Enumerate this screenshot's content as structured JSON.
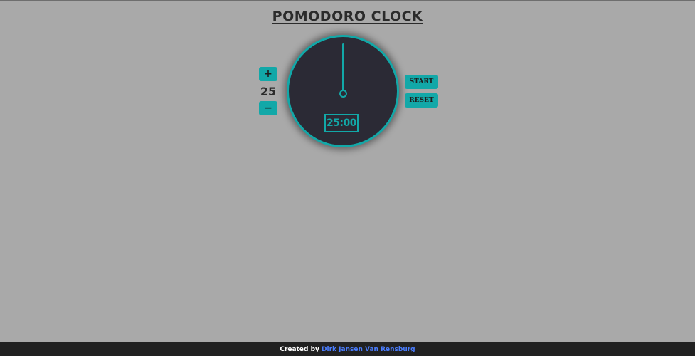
{
  "title": "POMODORO CLOCK",
  "session": {
    "plus_label": "+",
    "value": "25",
    "minus_label": "−"
  },
  "clock": {
    "display": "25:00"
  },
  "controls": {
    "start_label": "START",
    "reset_label": "RESET"
  },
  "footer": {
    "prefix": "Created by",
    "author": "Dirk Jansen Van Rensburg"
  },
  "colors": {
    "background": "#a9a9a9",
    "accent": "#12a8a8",
    "clock_face": "#2b2a35",
    "footer_bg": "#212121",
    "link": "#4a7dff"
  }
}
